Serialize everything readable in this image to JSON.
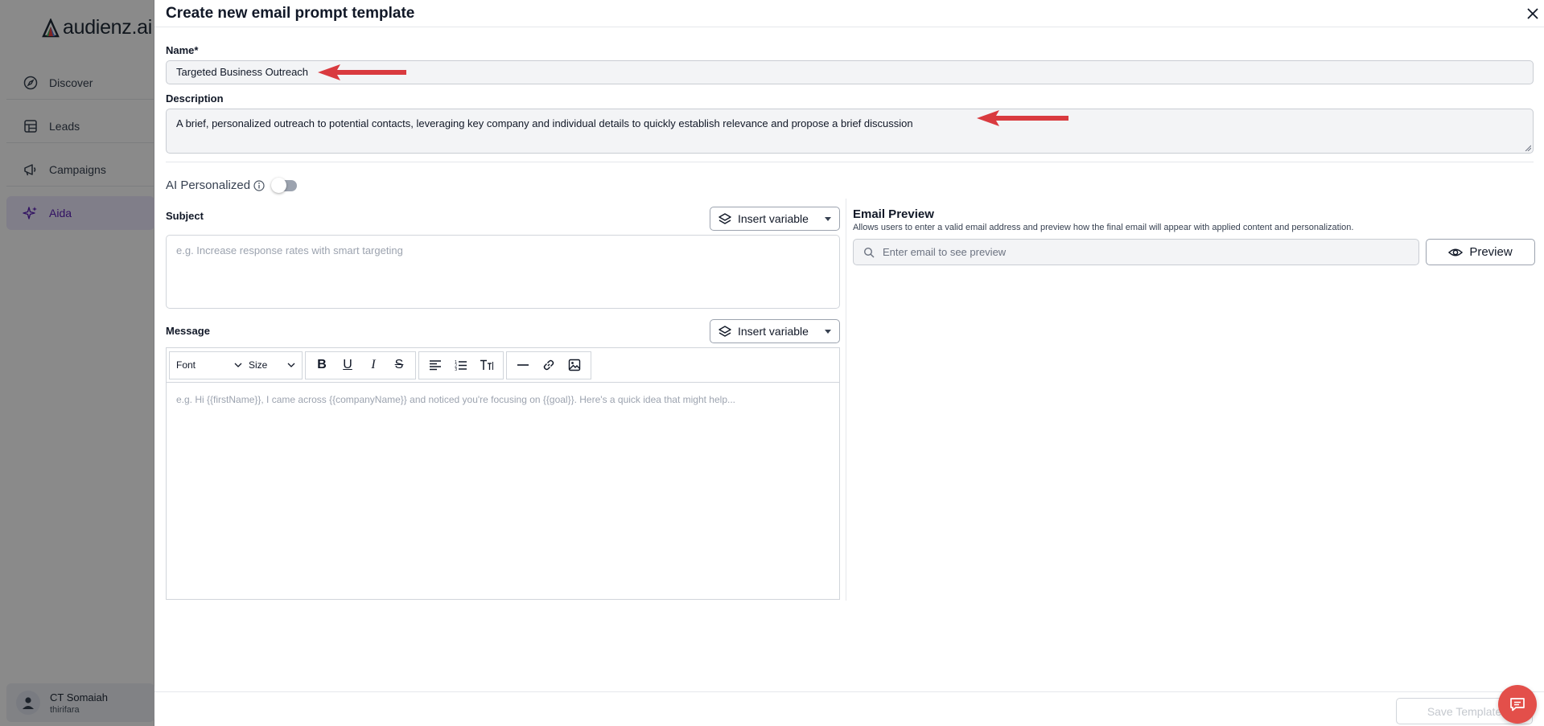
{
  "app": {
    "logo_text": "audienz.ai"
  },
  "sidebar": {
    "items": [
      {
        "label": "Discover",
        "icon": "compass-icon"
      },
      {
        "label": "Leads",
        "icon": "table-icon"
      },
      {
        "label": "Campaigns",
        "icon": "megaphone-icon"
      },
      {
        "label": "Aida",
        "icon": "sparkles-icon",
        "active": true
      }
    ],
    "user": {
      "name": "CT Somaiah",
      "org": "thirifara"
    }
  },
  "modal": {
    "title": "Create new email prompt template",
    "name_label": "Name*",
    "name_value": "Targeted Business Outreach",
    "description_label": "Description",
    "description_value": "A brief, personalized outreach to potential contacts, leveraging key company and individual details to quickly establish relevance and propose a brief discussion",
    "ai_personalized_label": "AI Personalized",
    "ai_personalized_on": false,
    "subject_label": "Subject",
    "subject_placeholder": "e.g. Increase response rates with smart targeting",
    "insert_variable_label": "Insert variable",
    "message_label": "Message",
    "message_placeholder": "e.g. Hi {{firstName}}, I came across {{companyName}} and noticed you're focusing on {{goal}}. Here's a quick idea that might help...",
    "toolbar": {
      "font_label": "Font",
      "size_label": "Size",
      "bold": "B",
      "underline": "U",
      "italic": "I",
      "strike": "S"
    },
    "preview": {
      "title": "Email Preview",
      "description": "Allows users to enter a valid email address and preview how the final email will appear with applied content and personalization.",
      "input_placeholder": "Enter email to see preview",
      "button_label": "Preview"
    },
    "save_label": "Save Template"
  },
  "colors": {
    "accent": "#5b21b6",
    "annotation_arrow": "#d93a3f",
    "chat_button": "#e34f4a"
  }
}
